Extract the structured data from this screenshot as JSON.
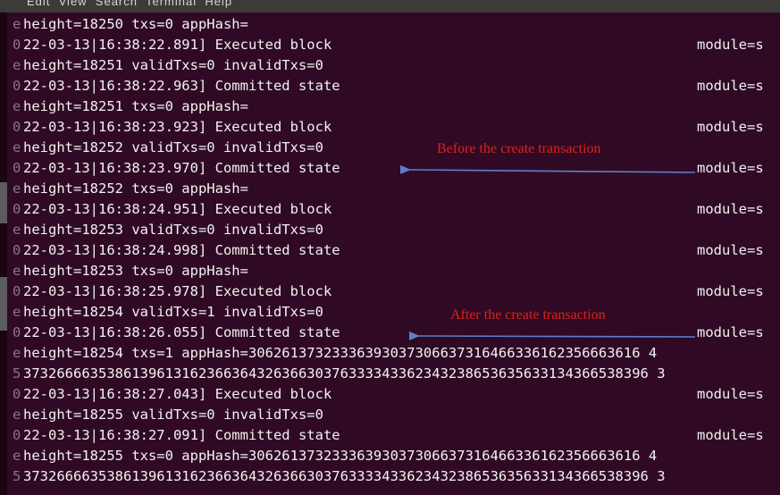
{
  "window": {
    "menu_text": "Edit  View  Search  Terminal  Help"
  },
  "log_lines": [
    {
      "prefix": "e",
      "text": "height=18250 txs=0 appHash=",
      "module": ""
    },
    {
      "prefix": "0",
      "text": "22-03-13|16:38:22.891] Executed block",
      "module": "module=s"
    },
    {
      "prefix": "e",
      "text": "height=18251 validTxs=0 invalidTxs=0",
      "module": ""
    },
    {
      "prefix": "0",
      "text": "22-03-13|16:38:22.963] Committed state",
      "module": "module=s"
    },
    {
      "prefix": "e",
      "text": "height=18251 txs=0 appHash=",
      "module": ""
    },
    {
      "prefix": "0",
      "text": "22-03-13|16:38:23.923] Executed block",
      "module": "module=s"
    },
    {
      "prefix": "e",
      "text": "height=18252 validTxs=0 invalidTxs=0",
      "module": ""
    },
    {
      "prefix": "0",
      "text": "22-03-13|16:38:23.970] Committed state",
      "module": "module=s"
    },
    {
      "prefix": "e",
      "text": "height=18252 txs=0 appHash=",
      "module": ""
    },
    {
      "prefix": "0",
      "text": "22-03-13|16:38:24.951] Executed block",
      "module": "module=s"
    },
    {
      "prefix": "e",
      "text": "height=18253 validTxs=0 invalidTxs=0",
      "module": ""
    },
    {
      "prefix": "0",
      "text": "22-03-13|16:38:24.998] Committed state",
      "module": "module=s"
    },
    {
      "prefix": "e",
      "text": "height=18253 txs=0 appHash=",
      "module": ""
    },
    {
      "prefix": "0",
      "text": "22-03-13|16:38:25.978] Executed block",
      "module": "module=s"
    },
    {
      "prefix": "e",
      "text": "height=18254 validTxs=1 invalidTxs=0",
      "module": ""
    },
    {
      "prefix": "0",
      "text": "22-03-13|16:38:26.055] Committed state",
      "module": "module=s"
    },
    {
      "prefix": "e",
      "text": "height=18254 txs=1 appHash=30626137323336393037306637316466336162356663616 4",
      "module": ""
    },
    {
      "prefix": "5",
      "text": "373266663538613961316236636432636630376333343362343238653635633134366538396 3",
      "module": ""
    },
    {
      "prefix": "0",
      "text": "22-03-13|16:38:27.043] Executed block",
      "module": "module=s"
    },
    {
      "prefix": "e",
      "text": "height=18255 validTxs=0 invalidTxs=0",
      "module": ""
    },
    {
      "prefix": "0",
      "text": "22-03-13|16:38:27.091] Committed state",
      "module": "module=s"
    },
    {
      "prefix": "e",
      "text": "height=18255 txs=0 appHash=30626137323336393037306637316466336162356663616 4",
      "module": ""
    },
    {
      "prefix": "5",
      "text": "373266663538613961316236636432636630376333343362343238653635633134366538396 3",
      "module": ""
    }
  ],
  "annotations": [
    {
      "text": "Before the create transaction",
      "color": "#e0201a"
    },
    {
      "text": "After the create transaction",
      "color": "#e0201a"
    }
  ],
  "colors": {
    "terminal_bg": "#300a24",
    "terminal_text": "#f2f2f2",
    "arrow": "#5b7fc9"
  }
}
